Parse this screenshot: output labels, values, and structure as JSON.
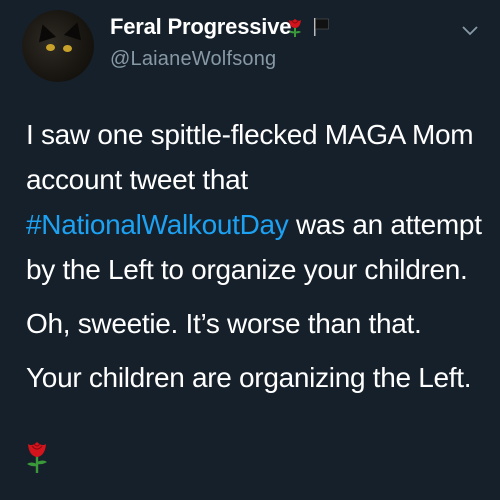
{
  "tweet": {
    "author": {
      "display_name": "Feral Progressive",
      "handle": "@LaianeWolfsong",
      "badges": [
        "rose-icon",
        "black-flag-icon"
      ]
    },
    "body": {
      "p1_before": "I saw one spittle-flecked MAGA Mom account tweet that ",
      "hashtag": "#NationalWalkoutDay",
      "p1_after": " was an attempt by the Left to organize your children.",
      "p2": "Oh, sweetie. It’s worse than that.",
      "p3": "Your children are organizing the Left."
    },
    "trailing_emoji": "rose-icon",
    "colors": {
      "background": "#15202b",
      "text": "#ffffff",
      "secondary": "#8899a6",
      "link": "#1da1f2",
      "rose": "#d4141c"
    }
  }
}
